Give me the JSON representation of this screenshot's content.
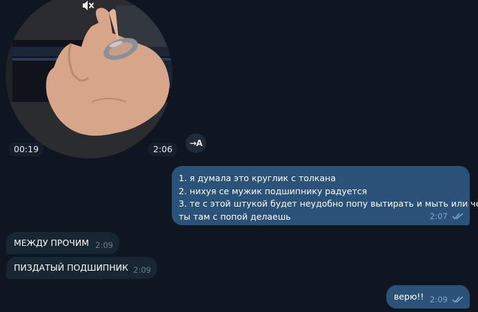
{
  "video_message": {
    "duration": "00:19",
    "time": "2:06",
    "muted_icon": "muted-speaker-icon"
  },
  "translate_button": {
    "label": "→A",
    "icon": "translate-icon"
  },
  "messages": [
    {
      "direction": "outgoing",
      "lines": [
        "1. я думала это круглик с толкана",
        "2. нихуя се мужик подшипнику радуется",
        "3. те с этой штукой будет неудобно попу вытирать и мыть или че",
        "ты там с попой делаешь"
      ],
      "time": "2:07",
      "status_icon": "double-check-icon"
    },
    {
      "direction": "incoming",
      "text": "МЕЖДУ ПРОЧИМ",
      "time": "2:09"
    },
    {
      "direction": "incoming",
      "text": "ПИЗДАТЫЙ ПОДШИПНИК",
      "time": "2:09"
    },
    {
      "direction": "outgoing",
      "text": "верю!!",
      "time": "2:09",
      "status_icon": "double-check-icon"
    }
  ],
  "colors": {
    "background": "#0e1621",
    "outgoing_bubble": "#2b5278",
    "incoming_bubble": "#182533",
    "outgoing_time": "#7da8d3",
    "incoming_time": "#6d7f8f"
  }
}
